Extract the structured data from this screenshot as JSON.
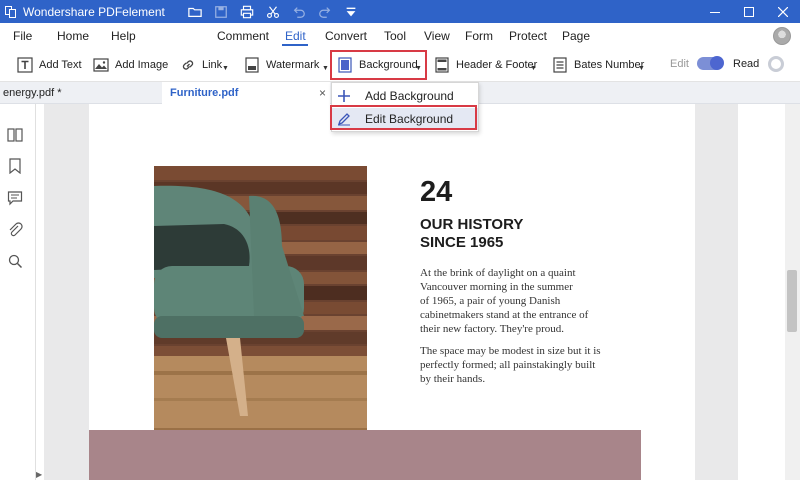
{
  "app": {
    "title": "Wondershare PDFelement"
  },
  "colors": {
    "accent": "#2f63c8",
    "highlight": "#d83a45",
    "band": "#a8858a"
  },
  "menu": {
    "file": "File",
    "home": "Home",
    "help": "Help",
    "comment": "Comment",
    "edit": "Edit",
    "convert": "Convert",
    "tool": "Tool",
    "view": "View",
    "form": "Form",
    "protect": "Protect",
    "page": "Page",
    "active": "Edit"
  },
  "toolbar": {
    "add_text": "Add Text",
    "add_image": "Add Image",
    "link": "Link",
    "watermark": "Watermark",
    "background": "Background",
    "header_footer": "Header & Footer",
    "bates_number": "Bates Number",
    "edit": "Edit",
    "read": "Read"
  },
  "tabs": [
    {
      "label": "energy.pdf *"
    },
    {
      "label": "Furniture.pdf",
      "close": "×"
    }
  ],
  "dropdown": {
    "add_background": "Add Background",
    "edit_background": "Edit Background"
  },
  "document": {
    "number": "24",
    "heading_line1": "OUR HISTORY",
    "heading_line2": "SINCE 1965",
    "para1": [
      "At the brink of daylight on a quaint",
      "Vancouver morning in the summer",
      "of 1965, a pair of young Danish",
      "cabinetmakers stand at the entrance of",
      "their new factory. They're proud."
    ],
    "para2": [
      "The space may be modest in size but it is",
      "perfectly formed; all painstakingly built",
      "by their hands."
    ]
  }
}
